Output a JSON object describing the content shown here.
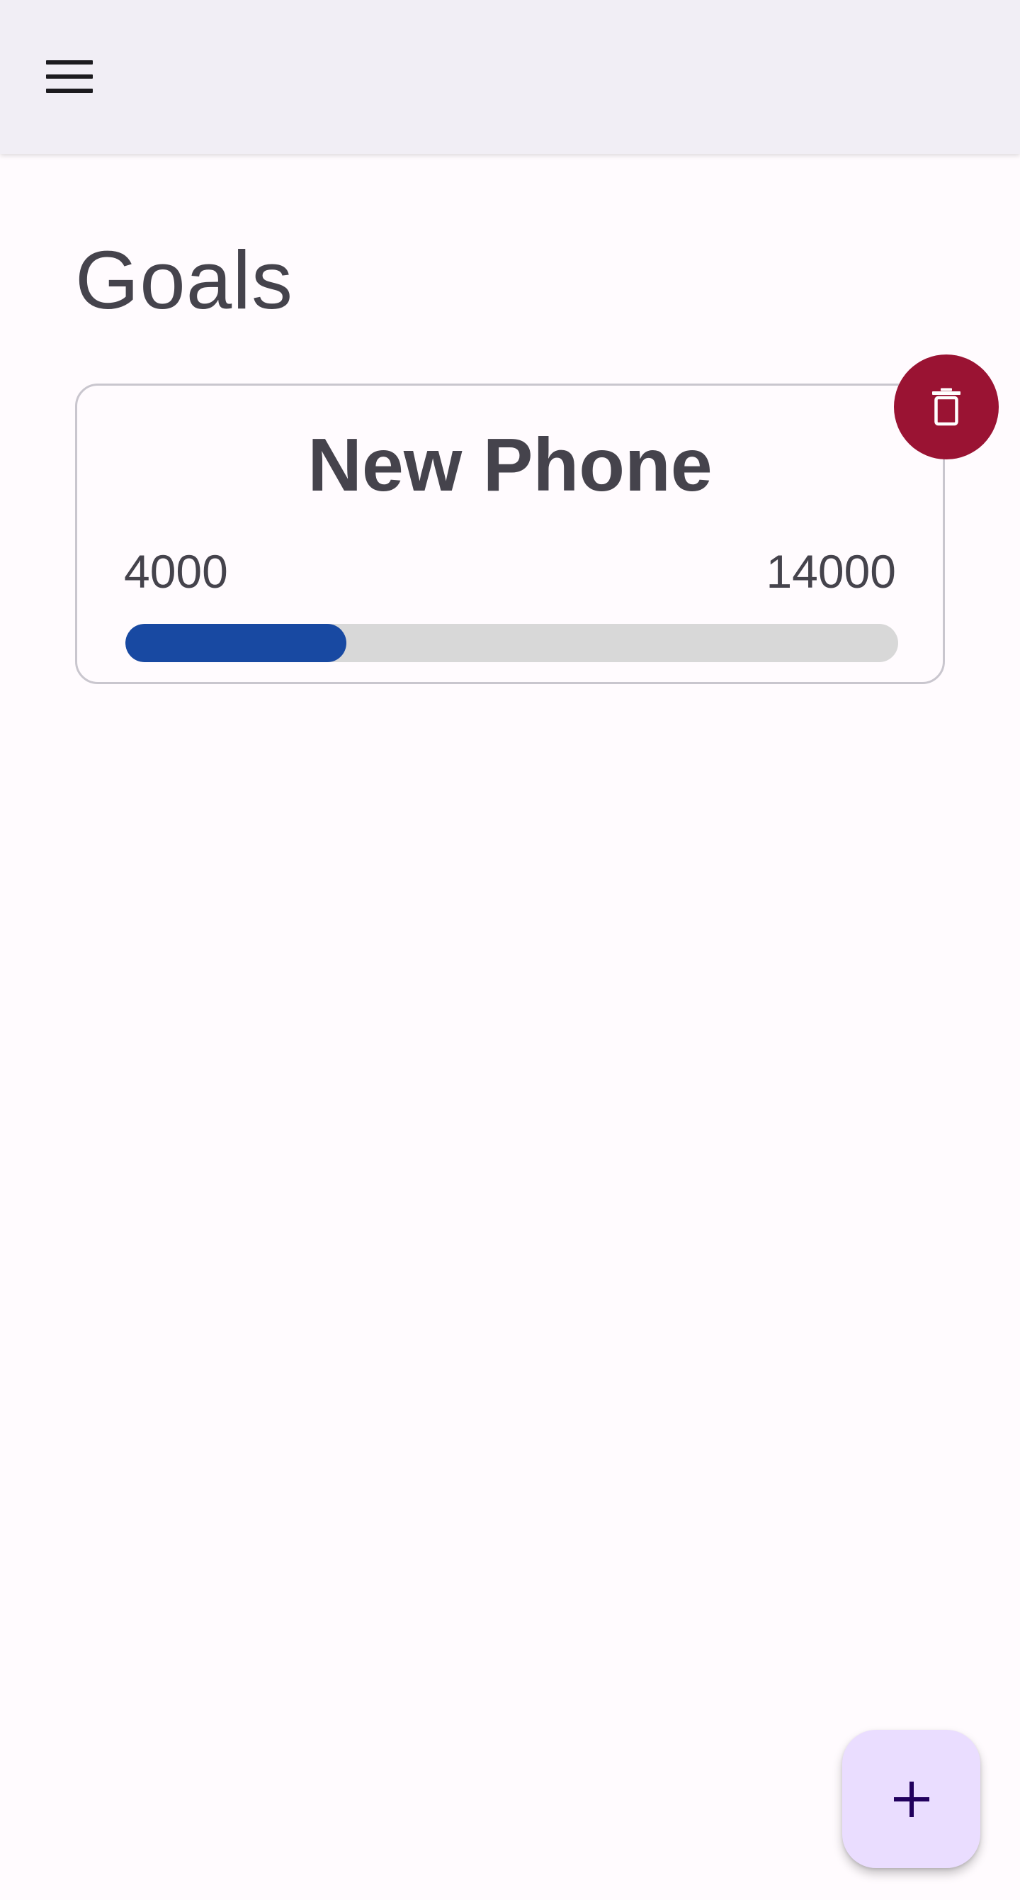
{
  "app_bar": {
    "menu_icon": "menu-icon",
    "background": "#F1EEF5"
  },
  "page": {
    "title": "Goals"
  },
  "goals": [
    {
      "name": "New Phone",
      "current": "4000",
      "target": "14000",
      "progress_fraction": 0.2857,
      "delete_icon": "trash-icon"
    }
  ],
  "fab": {
    "icon": "plus-icon"
  },
  "colors": {
    "progress_fill": "#1849A2",
    "progress_track": "#D8D8D8",
    "delete_button": "#9A1333",
    "fab_background": "#EADDFF",
    "text": "#45434C"
  }
}
